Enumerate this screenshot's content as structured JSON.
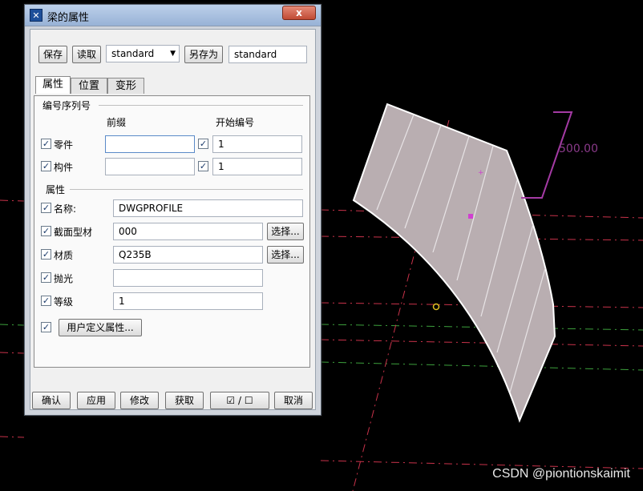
{
  "dialog": {
    "title": "梁的属性",
    "close_label": "x",
    "save_label": "保存",
    "load_label": "读取",
    "preset_value": "standard",
    "save_as_label": "另存为",
    "save_as_value": "standard"
  },
  "tabs": [
    {
      "label": "属性",
      "selected": true
    },
    {
      "label": "位置",
      "selected": false
    },
    {
      "label": "变形",
      "selected": false
    }
  ],
  "numbering": {
    "group_title": "编号序列号",
    "prefix_header": "前缀",
    "start_header": "开始编号",
    "rows": [
      {
        "label": "零件",
        "checked": true,
        "prefix": "",
        "start_checked": true,
        "start": "1"
      },
      {
        "label": "构件",
        "checked": true,
        "prefix": "",
        "start_checked": true,
        "start": "1"
      }
    ]
  },
  "attributes": {
    "group_title": "属性",
    "select_label": "选择...",
    "rows": [
      {
        "label": "名称:",
        "checked": true,
        "value": "DWGPROFILE"
      },
      {
        "label": "截面型材",
        "checked": true,
        "value": "000"
      },
      {
        "label": "材质",
        "checked": true,
        "value": "Q235B"
      },
      {
        "label": "抛光",
        "checked": true,
        "value": ""
      },
      {
        "label": "等级",
        "checked": true,
        "value": "1"
      }
    ],
    "udf_label": "用户定义属性..."
  },
  "footer": {
    "ok_label": "确认",
    "apply_label": "应用",
    "modify_label": "修改",
    "get_label": "获取",
    "toggle_label": "☑ / ☐",
    "cancel_label": "取消"
  },
  "viewport": {
    "dimension_label": "500.00",
    "watermark": "CSDN @piontionskaimit"
  },
  "colors": {
    "background": "#000000",
    "beam_fill": "#b9aeb1",
    "dimension": "#8a3a8a",
    "grid_red": "#c8324a",
    "grid_green": "#3ca03c"
  }
}
